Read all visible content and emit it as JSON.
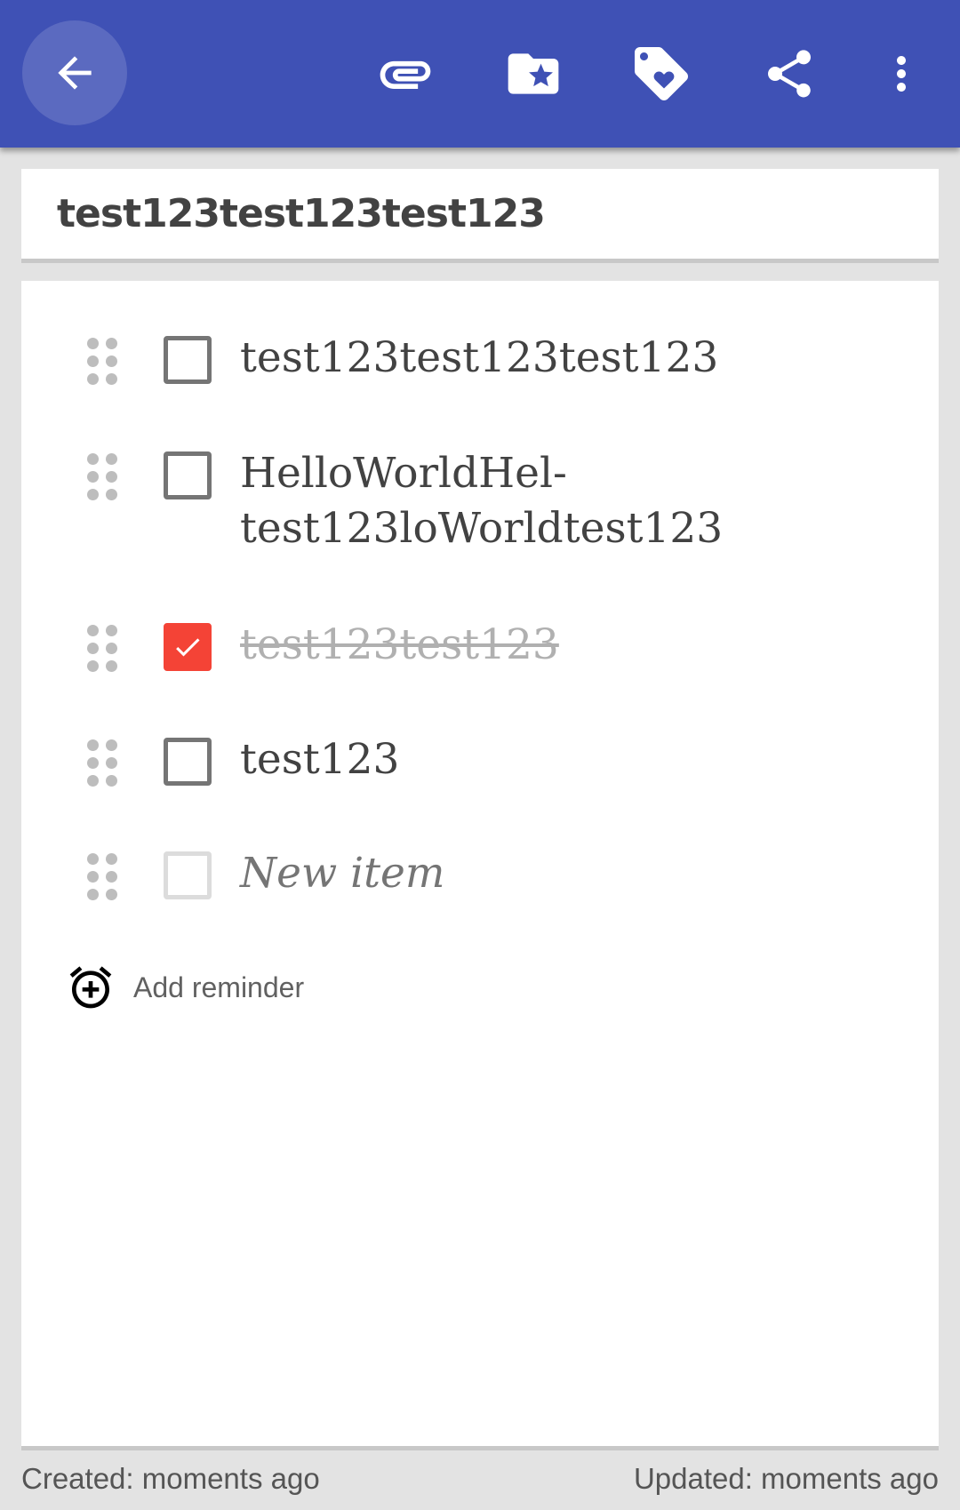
{
  "toolbar": {
    "back_icon": "arrow-back-icon",
    "actions": [
      "attachment-icon",
      "folder-star-icon",
      "tag-heart-icon",
      "share-icon",
      "more-vert-icon"
    ],
    "color": "#3f51b5"
  },
  "note": {
    "title": "test123test123test123",
    "items": [
      {
        "text": "test123test123test123",
        "checked": false
      },
      {
        "text_line1": "HelloWorldHel-",
        "text_line2": "test123loWorldtest123",
        "checked": false
      },
      {
        "text": "test123test123",
        "checked": true
      },
      {
        "text": "test123",
        "checked": false
      }
    ],
    "new_item_placeholder": "New item",
    "checked_color": "#f44336"
  },
  "reminder": {
    "label": "Add reminder"
  },
  "footer": {
    "created": "Created: moments ago",
    "updated": "Updated: moments ago"
  }
}
